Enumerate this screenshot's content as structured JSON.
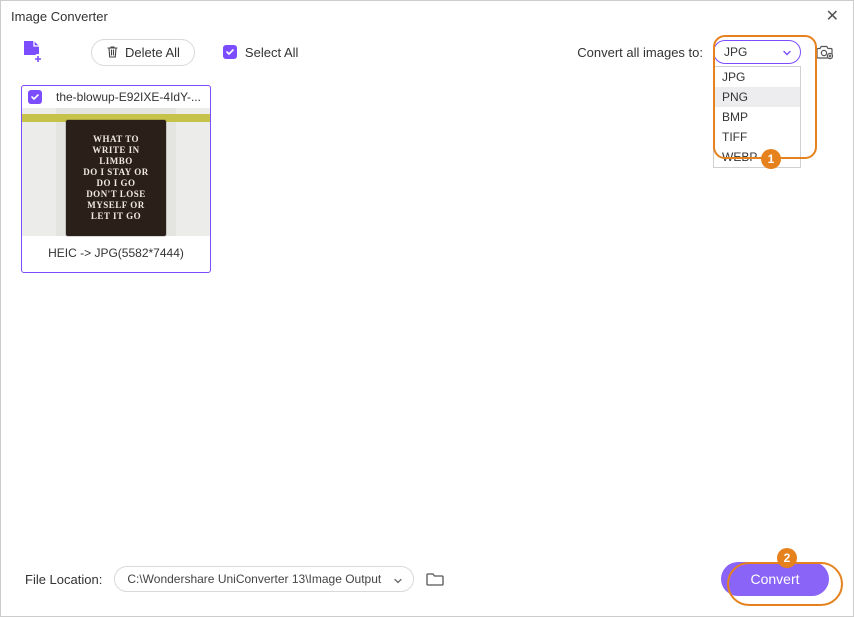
{
  "window": {
    "title": "Image Converter"
  },
  "toolbar": {
    "delete_all": "Delete All",
    "select_all": "Select All",
    "convert_to_label": "Convert all images to:",
    "format_selected": "JPG",
    "format_options": [
      "JPG",
      "PNG",
      "BMP",
      "TIFF",
      "WEBP"
    ],
    "format_highlight": "PNG"
  },
  "card": {
    "filename": "the-blowup-E92IXE-4IdY-...",
    "conversion": "HEIC -> JPG(5582*7444)",
    "poster_lines": [
      "WHAT TO",
      "WRITE IN",
      "LIMBO",
      "DO I STAY OR",
      "DO I GO",
      "DON'T LOSE",
      "MYSELF OR",
      "LET IT GO"
    ]
  },
  "bottom": {
    "file_location_label": "File Location:",
    "file_location_value": "C:\\Wondershare UniConverter 13\\Image Output",
    "convert": "Convert"
  },
  "annotations": {
    "b1": "1",
    "b2": "2"
  }
}
